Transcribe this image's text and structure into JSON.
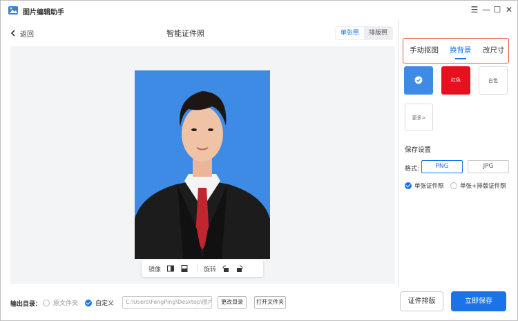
{
  "app": {
    "title": "图片编辑助手"
  },
  "header": {
    "back_label": "返回",
    "page_title": "智能证件照",
    "mode_tabs": [
      "单张照",
      "排版照"
    ],
    "active_mode": 0
  },
  "preview_toolbar": {
    "mirror_label": "镜像",
    "rotate_label": "旋转"
  },
  "bottom": {
    "output_label": "输出目录：",
    "option_original": "原文件夹",
    "option_custom": "自定义",
    "path_value": "C:\\Users\\FengPing\\Desktop\\图片",
    "change_dir": "更改目录",
    "open_folder": "打开文件夹",
    "layout_btn": "证件排版",
    "save_btn": "立即保存"
  },
  "panel": {
    "tabs": [
      "手动抠图",
      "换背景",
      "改尺寸"
    ],
    "active_tab": 1,
    "swatches": [
      {
        "label": "",
        "color": "#3e8be6",
        "selected": true
      },
      {
        "label": "红色",
        "color": "#e8101f"
      },
      {
        "label": "白色",
        "color": "#ffffff"
      }
    ],
    "more_label": "更多>",
    "save_settings": "保存设置",
    "format_label": "格式:",
    "formats": [
      "PNG",
      "JPG"
    ],
    "active_format": 0,
    "output_opts": [
      "单张证件照",
      "单张+排版证件照"
    ],
    "active_opt": 0
  },
  "colors": {
    "accent": "#1a73e8",
    "highlight_border": "#e2583e"
  }
}
